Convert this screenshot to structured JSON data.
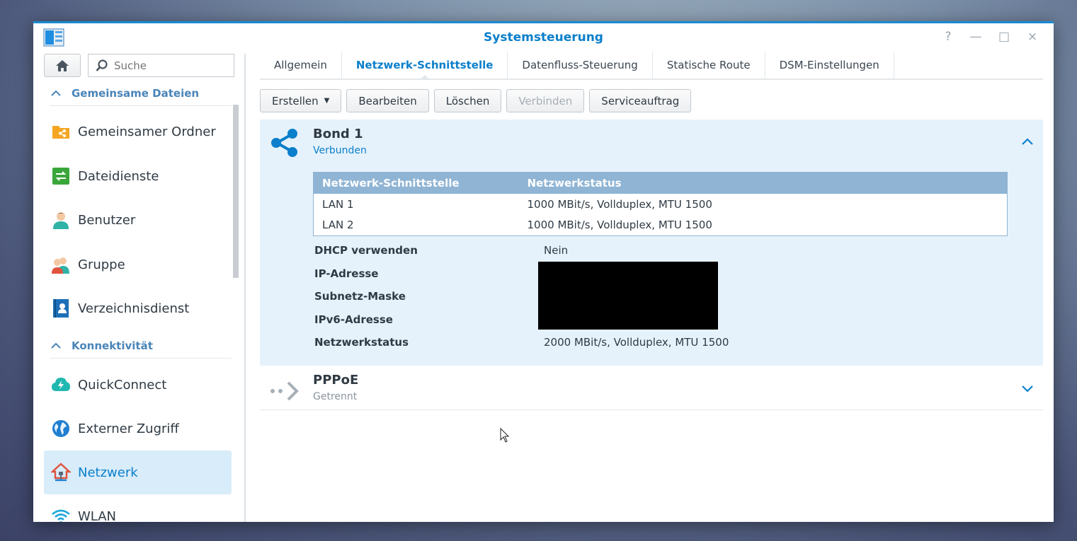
{
  "window": {
    "title": "Systemsteuerung",
    "controls": [
      "?",
      "—",
      "□",
      "×"
    ]
  },
  "sidebar": {
    "search_placeholder": "Suche",
    "sections": [
      {
        "title": "Gemeinsame Dateien",
        "items": [
          {
            "label": "Gemeinsamer Ordner",
            "icon": "shared-folder-icon"
          },
          {
            "label": "Dateidienste",
            "icon": "file-services-icon"
          },
          {
            "label": "Benutzer",
            "icon": "user-icon"
          },
          {
            "label": "Gruppe",
            "icon": "group-icon"
          },
          {
            "label": "Verzeichnisdienst",
            "icon": "directory-service-icon"
          }
        ]
      },
      {
        "title": "Konnektivität",
        "items": [
          {
            "label": "QuickConnect",
            "icon": "quickconnect-icon"
          },
          {
            "label": "Externer Zugriff",
            "icon": "globe-icon"
          },
          {
            "label": "Netzwerk",
            "icon": "network-house-icon",
            "active": true
          },
          {
            "label": "WLAN",
            "icon": "wifi-icon"
          }
        ]
      }
    ]
  },
  "tabs": [
    {
      "label": "Allgemein"
    },
    {
      "label": "Netzwerk-Schnittstelle",
      "active": true
    },
    {
      "label": "Datenfluss-Steuerung"
    },
    {
      "label": "Statische Route"
    },
    {
      "label": "DSM-Einstellungen"
    }
  ],
  "toolbar": {
    "create": "Erstellen",
    "edit": "Bearbeiten",
    "delete": "Löschen",
    "connect": "Verbinden",
    "service": "Serviceauftrag"
  },
  "interfaces": [
    {
      "name": "Bond 1",
      "status": "Verbunden",
      "expanded": true,
      "table": {
        "headers": [
          "Netzwerk-Schnittstelle",
          "Netzwerkstatus"
        ],
        "rows": [
          [
            "LAN 1",
            "1000 MBit/s, Vollduplex, MTU 1500"
          ],
          [
            "LAN 2",
            "1000 MBit/s, Vollduplex, MTU 1500"
          ]
        ]
      },
      "properties": [
        {
          "label": "DHCP verwenden",
          "value": "Nein"
        },
        {
          "label": "IP-Adresse",
          "value": ""
        },
        {
          "label": "Subnetz-Maske",
          "value": ""
        },
        {
          "label": "IPv6-Adresse",
          "value": ""
        },
        {
          "label": "Netzwerkstatus",
          "value": "2000 MBit/s, Vollduplex, MTU 1500"
        }
      ]
    },
    {
      "name": "PPPoE",
      "status": "Getrennt",
      "expanded": false
    }
  ],
  "colors": {
    "accent": "#0b7fcb",
    "selected_bg": "#d8ecfa",
    "expanded_panel_bg": "#e6f2fb",
    "table_header": "#8fb4d4"
  }
}
